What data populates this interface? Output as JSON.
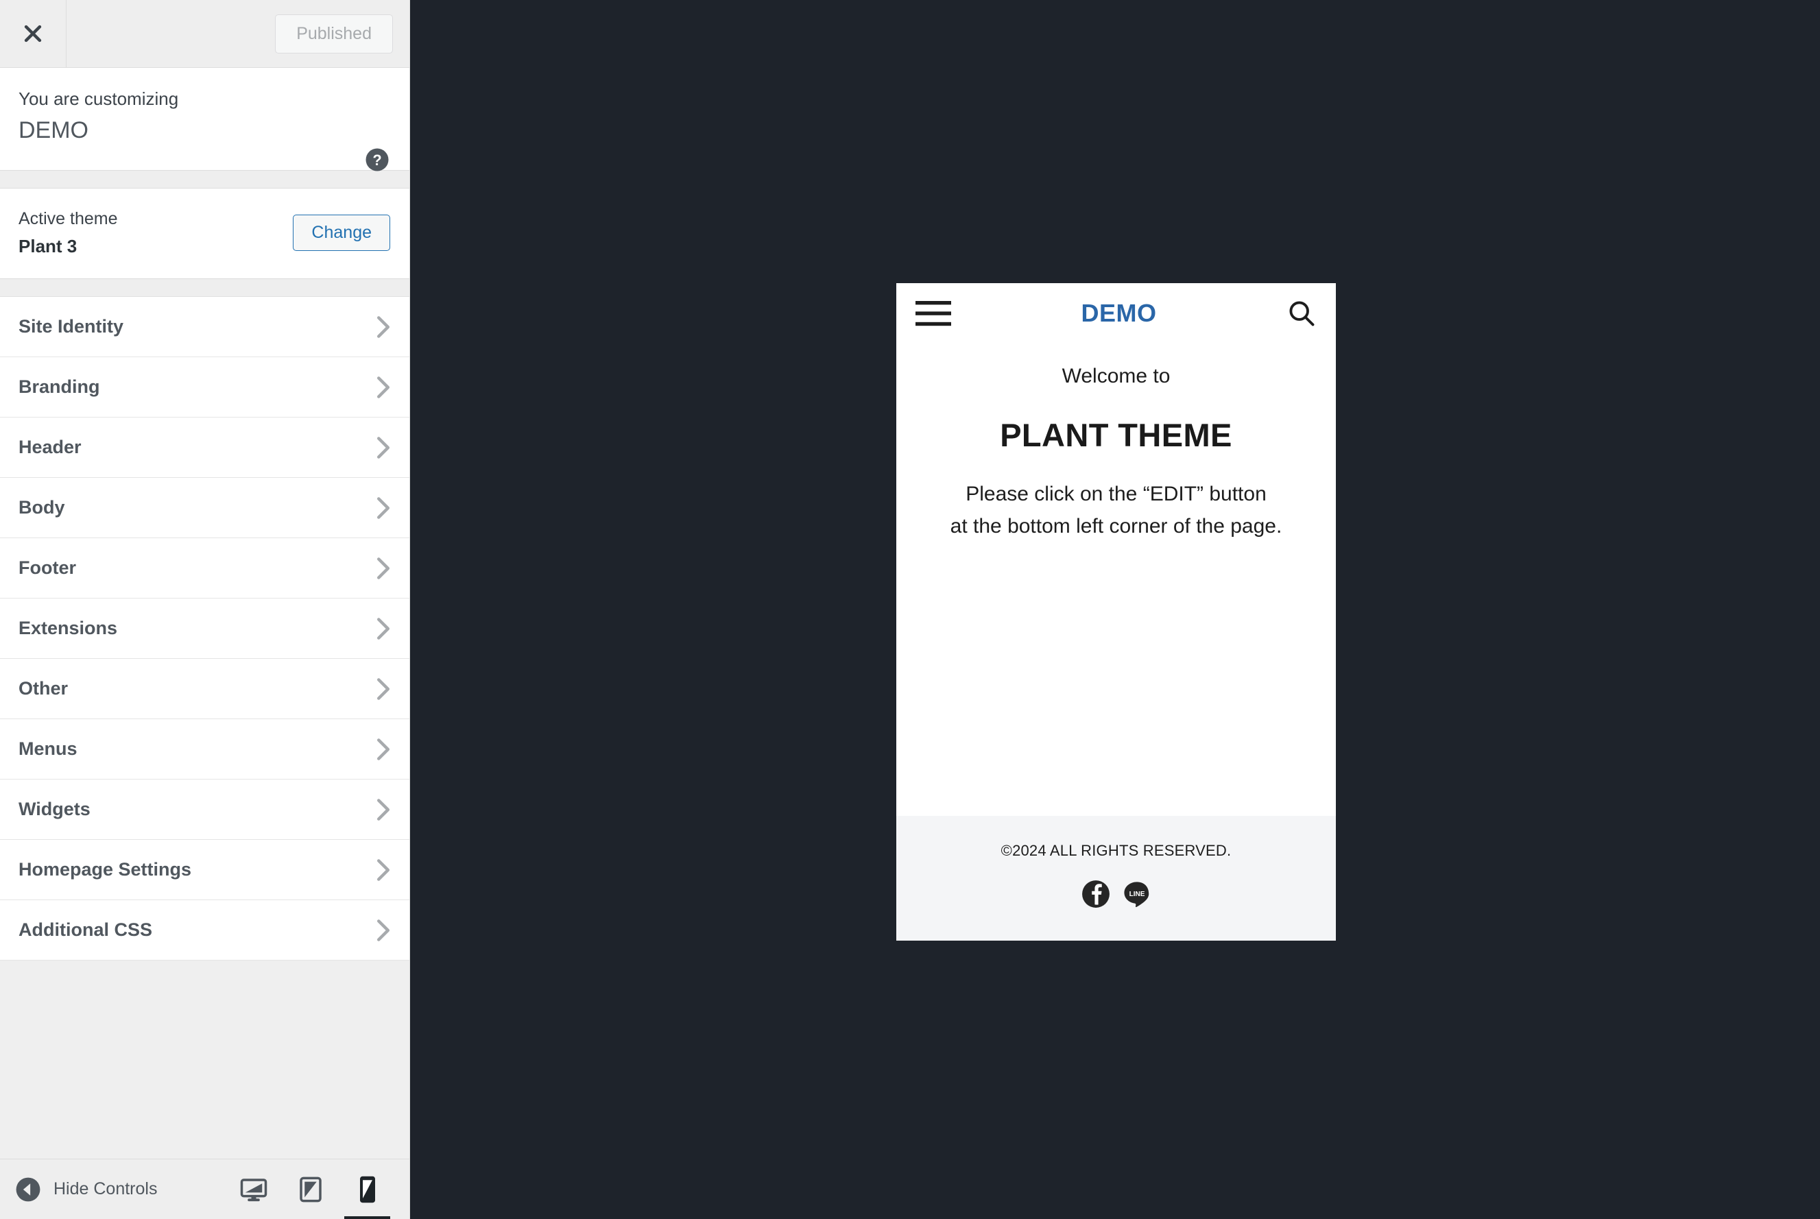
{
  "customizer": {
    "close_label": "Close",
    "publish_button": "Published",
    "info_label": "You are customizing",
    "site_title": "DEMO",
    "help_label": "Help",
    "active_theme_label": "Active theme",
    "active_theme_name": "Plant 3",
    "change_button": "Change",
    "nav_items": [
      {
        "label": "Site Identity"
      },
      {
        "label": "Branding"
      },
      {
        "label": "Header"
      },
      {
        "label": "Body"
      },
      {
        "label": "Footer"
      },
      {
        "label": "Extensions"
      },
      {
        "label": "Other"
      },
      {
        "label": "Menus"
      },
      {
        "label": "Widgets"
      },
      {
        "label": "Homepage Settings"
      },
      {
        "label": "Additional CSS"
      }
    ],
    "footer": {
      "hide_controls_label": "Hide Controls",
      "devices": [
        {
          "name": "desktop",
          "active": false
        },
        {
          "name": "tablet",
          "active": false
        },
        {
          "name": "mobile",
          "active": true
        }
      ]
    }
  },
  "preview": {
    "header": {
      "menu_label": "Menu",
      "logo": "DEMO",
      "search_label": "Search"
    },
    "content": {
      "welcome": "Welcome to",
      "title": "PLANT THEME",
      "instruction_line1": "Please click on the “EDIT” button",
      "instruction_line2": "at the bottom left corner of the page."
    },
    "footer": {
      "copyright": "©2024 ALL RIGHTS RESERVED.",
      "social": [
        {
          "name": "facebook",
          "label": "Facebook"
        },
        {
          "name": "line",
          "label": "LINE"
        }
      ]
    }
  },
  "colors": {
    "logo_blue": "#2a66a8",
    "accent_blue": "#2271b1",
    "dark_bg": "#1e232b",
    "sidebar_bg": "#eeeeee",
    "footer_bg": "#f4f5f7"
  }
}
